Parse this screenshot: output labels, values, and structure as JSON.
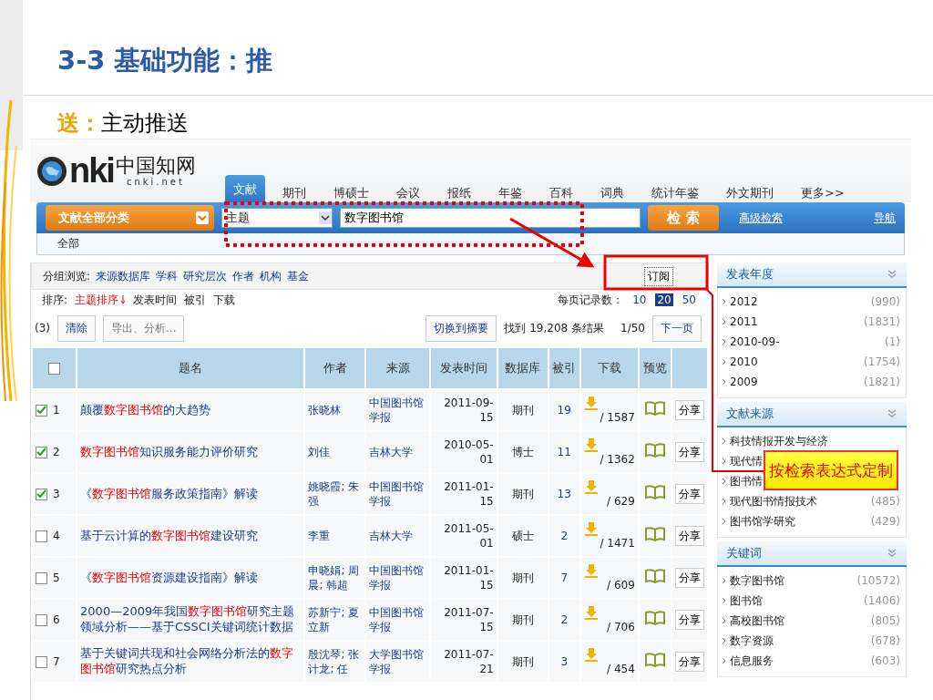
{
  "slide": {
    "title": "3-3 基础功能：推",
    "subtitle_lead": "送：",
    "subtitle": "主动推送"
  },
  "logo": {
    "mark": "nki",
    "name": "中国知网",
    "domain": "cnki.net"
  },
  "nav_tabs": [
    {
      "label": "文献",
      "selected": true
    },
    {
      "label": "期刊",
      "selected": false
    },
    {
      "label": "博硕士",
      "selected": false
    },
    {
      "label": "会议",
      "selected": false
    },
    {
      "label": "报纸",
      "selected": false
    },
    {
      "label": "年鉴",
      "selected": false
    },
    {
      "label": "百科",
      "selected": false
    },
    {
      "label": "词典",
      "selected": false
    },
    {
      "label": "统计年鉴",
      "selected": false
    },
    {
      "label": "外文期刊",
      "selected": false
    },
    {
      "label": "更多>>",
      "selected": false
    }
  ],
  "search": {
    "category": "文献全部分类",
    "field": "主题",
    "query": "数字图书馆",
    "button": "检 索",
    "links": [
      "高级检索",
      "导航"
    ],
    "scope": "全部"
  },
  "group_browse": {
    "label": "分组浏览:",
    "links": [
      "来源数据库",
      "学科",
      "研究层次",
      "作者",
      "机构",
      "基金"
    ]
  },
  "subscribe": "订阅",
  "sort": {
    "label": "排序:",
    "options": [
      {
        "label": "主题排序",
        "selected": true
      },
      {
        "label": "发表时间",
        "selected": false
      },
      {
        "label": "被引",
        "selected": false
      },
      {
        "label": "下载",
        "selected": false
      }
    ]
  },
  "per_page": {
    "label": "每页记录数：",
    "options": [
      {
        "label": "10",
        "selected": false
      },
      {
        "label": "20",
        "selected": true
      },
      {
        "label": "50",
        "selected": false
      }
    ]
  },
  "toolbar": {
    "count": "(3)",
    "clear": "清除",
    "export": "导出、分析...",
    "switch": "切换到摘要",
    "results": "找到 19,208 条结果",
    "page": "1/50",
    "next": "下一页"
  },
  "table": {
    "header_checked": false,
    "columns": [
      "题名",
      "作者",
      "来源",
      "发表时间",
      "数据库",
      "被引",
      "下载",
      "预览"
    ],
    "rows": [
      {
        "checked": true,
        "index": "1",
        "title": [
          {
            "text": "颠覆",
            "hit": false
          },
          {
            "text": "数字图书馆",
            "hit": true
          },
          {
            "text": "的大趋势",
            "hit": false
          }
        ],
        "author": "张晓林",
        "source": "中国图书馆学报",
        "date": "2011-09-15",
        "db": "期刊",
        "cited": "19",
        "downloads": "/ 1587",
        "share": "分享"
      },
      {
        "checked": true,
        "index": "2",
        "title": [
          {
            "text": "数字图书馆",
            "hit": true
          },
          {
            "text": "知识服务能力评价研究",
            "hit": false
          }
        ],
        "author": "刘佳",
        "source": "吉林大学",
        "date": "2010-05-01",
        "db": "博士",
        "cited": "11",
        "downloads": "/ 1362",
        "share": "分享"
      },
      {
        "checked": true,
        "index": "3",
        "title": [
          {
            "text": "《",
            "hit": false
          },
          {
            "text": "数字图书馆",
            "hit": true
          },
          {
            "text": "服务政策指南》解读",
            "hit": false
          }
        ],
        "author": "姚晓霞; 朱强",
        "source": "中国图书馆学报",
        "date": "2011-01-15",
        "db": "期刊",
        "cited": "13",
        "downloads": "/ 629",
        "share": "分享"
      },
      {
        "checked": false,
        "index": "4",
        "title": [
          {
            "text": "基于云计算的",
            "hit": false
          },
          {
            "text": "数字图书馆",
            "hit": true
          },
          {
            "text": "建设研究",
            "hit": false
          }
        ],
        "author": "李重",
        "source": "吉林大学",
        "date": "2011-05-01",
        "db": "硕士",
        "cited": "2",
        "downloads": "/ 1471",
        "share": "分享"
      },
      {
        "checked": false,
        "index": "5",
        "title": [
          {
            "text": "《",
            "hit": false
          },
          {
            "text": "数字图书馆",
            "hit": true
          },
          {
            "text": "资源建设指南》解读",
            "hit": false
          }
        ],
        "author": "申晓娟; 周晨; 韩超",
        "source": "中国图书馆学报",
        "date": "2011-01-15",
        "db": "期刊",
        "cited": "7",
        "downloads": "/ 609",
        "share": "分享"
      },
      {
        "checked": false,
        "index": "6",
        "title": [
          {
            "text": "2000—2009年我国",
            "hit": false
          },
          {
            "text": "数字图书馆",
            "hit": true
          },
          {
            "text": "研究主题领域分析——基于CSSCI关键词统计数据",
            "hit": false
          }
        ],
        "author": "苏新宁; 夏立新",
        "source": "中国图书馆学报",
        "date": "2011-07-15",
        "db": "期刊",
        "cited": "2",
        "downloads": "/ 706",
        "share": "分享"
      },
      {
        "checked": false,
        "index": "7",
        "title": [
          {
            "text": "基于关键词共现和社会网络分析法的",
            "hit": false
          },
          {
            "text": "数字图书馆",
            "hit": true
          },
          {
            "text": "研究热点分析",
            "hit": false
          }
        ],
        "author": "殷沈琴; 张计龙; 任",
        "source": "大学图书馆学报",
        "date": "2011-07-21",
        "db": "期刊",
        "cited": "3",
        "downloads": "/ 454",
        "share": "分享"
      }
    ]
  },
  "sidebar": [
    {
      "title": "发表年度",
      "items": [
        {
          "label": "2012",
          "count": "(990)"
        },
        {
          "label": "2011",
          "count": "(1831)"
        },
        {
          "label": "2010-09-",
          "count": "(1)"
        },
        {
          "label": "2010",
          "count": "(1754)"
        },
        {
          "label": "2009",
          "count": "(1821)"
        }
      ]
    },
    {
      "title": "文献来源",
      "items": [
        {
          "label": "科技情报开发与经济"
        },
        {
          "label": "现代情"
        },
        {
          "label": "图书情"
        },
        {
          "label": "现代图书情报技术",
          "count": "(485)"
        },
        {
          "label": "图书馆学研究",
          "count": "(429)"
        }
      ]
    },
    {
      "title": "关键词",
      "items": [
        {
          "label": "数字图书馆",
          "count": "(10572)"
        },
        {
          "label": "图书馆",
          "count": "(1406)"
        },
        {
          "label": "高校图书馆",
          "count": "(805)"
        },
        {
          "label": "数字资源",
          "count": "(678)"
        },
        {
          "label": "信息服务",
          "count": "(603)"
        }
      ]
    }
  ],
  "callout": "按检索表达式定制"
}
